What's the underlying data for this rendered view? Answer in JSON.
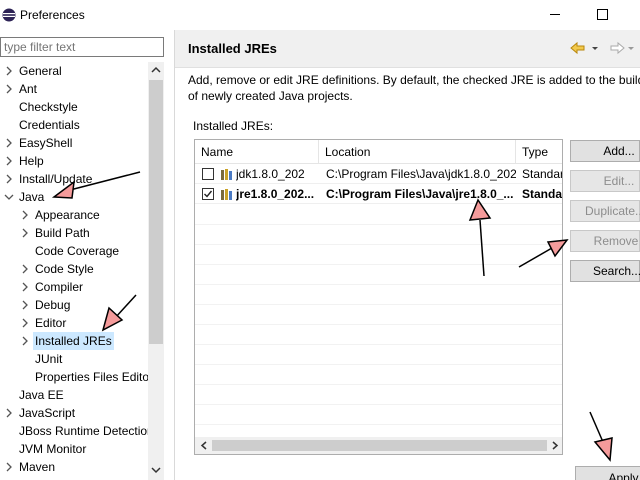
{
  "window": {
    "title": "Preferences"
  },
  "filter": {
    "placeholder": "type filter text"
  },
  "tree": {
    "items": [
      {
        "label": "General",
        "level": 0,
        "expander": "collapsed"
      },
      {
        "label": "Ant",
        "level": 0,
        "expander": "collapsed"
      },
      {
        "label": "Checkstyle",
        "level": 0,
        "expander": "none"
      },
      {
        "label": "Credentials",
        "level": 0,
        "expander": "none"
      },
      {
        "label": "EasyShell",
        "level": 0,
        "expander": "collapsed"
      },
      {
        "label": "Help",
        "level": 0,
        "expander": "collapsed"
      },
      {
        "label": "Install/Update",
        "level": 0,
        "expander": "collapsed"
      },
      {
        "label": "Java",
        "level": 0,
        "expander": "expanded"
      },
      {
        "label": "Appearance",
        "level": 1,
        "expander": "collapsed"
      },
      {
        "label": "Build Path",
        "level": 1,
        "expander": "collapsed"
      },
      {
        "label": "Code Coverage",
        "level": 1,
        "expander": "none"
      },
      {
        "label": "Code Style",
        "level": 1,
        "expander": "collapsed"
      },
      {
        "label": "Compiler",
        "level": 1,
        "expander": "collapsed"
      },
      {
        "label": "Debug",
        "level": 1,
        "expander": "collapsed"
      },
      {
        "label": "Editor",
        "level": 1,
        "expander": "collapsed"
      },
      {
        "label": "Installed JREs",
        "level": 1,
        "expander": "collapsed",
        "selected": true
      },
      {
        "label": "JUnit",
        "level": 1,
        "expander": "none"
      },
      {
        "label": "Properties Files Editor",
        "level": 1,
        "expander": "none"
      },
      {
        "label": "Java EE",
        "level": 0,
        "expander": "none"
      },
      {
        "label": "JavaScript",
        "level": 0,
        "expander": "collapsed"
      },
      {
        "label": "JBoss Runtime Detection",
        "level": 0,
        "expander": "none"
      },
      {
        "label": "JVM Monitor",
        "level": 0,
        "expander": "none"
      },
      {
        "label": "Maven",
        "level": 0,
        "expander": "collapsed"
      }
    ]
  },
  "page": {
    "title": "Installed JREs",
    "description_line1": "Add, remove or edit JRE definitions. By default, the checked JRE is added to the build path",
    "description_line2": "of newly created Java projects.",
    "list_label": "Installed JREs:"
  },
  "table": {
    "columns": [
      "Name",
      "Location",
      "Type"
    ],
    "rows": [
      {
        "checked": false,
        "name": "jdk1.8.0_202",
        "location": "C:\\Program Files\\Java\\jdk1.8.0_202",
        "type": "Standar",
        "bold": false
      },
      {
        "checked": true,
        "name": "jre1.8.0_202...",
        "location": "C:\\Program Files\\Java\\jre1.8.0_...",
        "type": "Standar",
        "bold": true
      }
    ]
  },
  "buttons": {
    "add": "Add...",
    "edit": "Edit...",
    "duplicate": "Duplicate...",
    "remove": "Remove",
    "search": "Search...",
    "apply": "Apply"
  },
  "colors": {
    "selection": "#cce8ff",
    "annotation_arrow_fill": "#f59b9b",
    "nav_back_arrow": "#f0c040"
  },
  "icons": {
    "app": "eclipse-icon",
    "back": "nav-back-icon",
    "forward": "nav-forward-icon",
    "jre": "jre-library-icon"
  }
}
